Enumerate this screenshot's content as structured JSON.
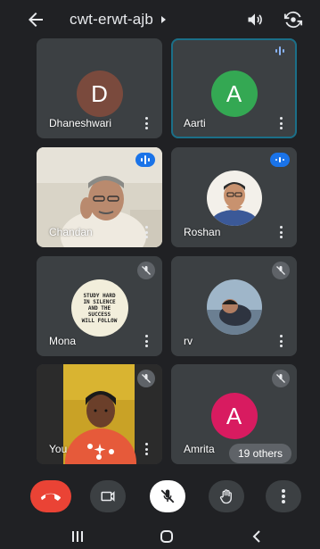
{
  "meeting": {
    "code": "cwt-erwt-ajb"
  },
  "colors": {
    "end_call": "#ea4335",
    "active_outline": "#1b6f88",
    "speaking_badge": "#1a73e8",
    "avatar_dhaneshwari": "#7a4a3d",
    "avatar_aarti": "#34a853",
    "avatar_amrita": "#d81b60"
  },
  "participants": [
    {
      "name": "Dhaneshwari",
      "initial": "D",
      "type": "avatar",
      "status": "none"
    },
    {
      "name": "Aarti",
      "initial": "A",
      "type": "avatar",
      "status": "speaking",
      "active": true
    },
    {
      "name": "Chandan",
      "type": "video",
      "status": "speaking"
    },
    {
      "name": "Roshan",
      "type": "photo",
      "status": "speaking"
    },
    {
      "name": "Mona",
      "type": "photo",
      "status": "muted",
      "photo_text": "STUDY HARD IN SILENCE AND THE SUCCESS WILL FOLLOW"
    },
    {
      "name": "rv",
      "type": "photo",
      "status": "muted"
    },
    {
      "name": "You",
      "type": "video",
      "status": "muted"
    },
    {
      "name": "Amrita",
      "initial": "A",
      "type": "avatar",
      "status": "muted"
    }
  ],
  "others_label": "19 others",
  "icons": {
    "back": "arrow-back-icon",
    "speaker": "speaker-icon",
    "flip": "flip-camera-icon",
    "end_call": "end-call-icon",
    "camera": "camera-icon",
    "mic": "mic-off-icon",
    "hand": "raise-hand-icon",
    "more": "more-icon"
  }
}
